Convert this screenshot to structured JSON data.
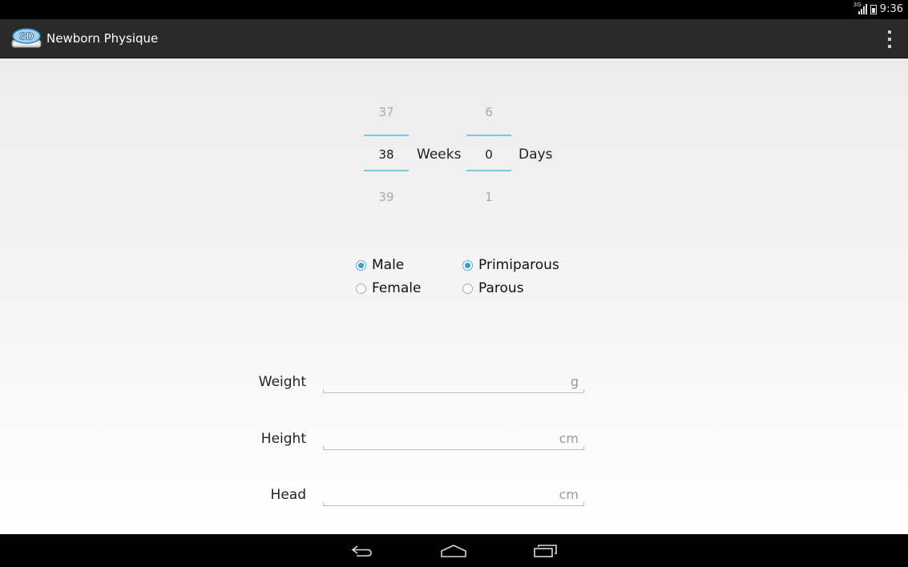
{
  "status_bar": {
    "network_type": "3G",
    "time": "9:36"
  },
  "action_bar": {
    "app_icon_text": "SD",
    "title": "Newborn Physique",
    "overflow_icon": "overflow-menu-icon"
  },
  "gestation_picker": {
    "weeks": {
      "prev": "37",
      "current": "38",
      "next": "39",
      "unit": "Weeks"
    },
    "days": {
      "prev": "6",
      "current": "0",
      "next": "1",
      "unit": "Days"
    },
    "accent_color": "#7ec6e6"
  },
  "sex": {
    "options": [
      {
        "label": "Male",
        "checked": true
      },
      {
        "label": "Female",
        "checked": false
      }
    ]
  },
  "parity": {
    "options": [
      {
        "label": "Primiparous",
        "checked": true
      },
      {
        "label": "Parous",
        "checked": false
      }
    ]
  },
  "measurements": [
    {
      "label": "Weight",
      "value": "",
      "placeholder": "g"
    },
    {
      "label": "Height",
      "value": "",
      "placeholder": "cm"
    },
    {
      "label": "Head",
      "value": "",
      "placeholder": "cm"
    }
  ],
  "nav_bar": {
    "buttons": [
      "back-icon",
      "home-icon",
      "recent-apps-icon"
    ]
  },
  "colors": {
    "radio_checked": "#33a0d6",
    "action_bar_bg": "#2a2a2a"
  }
}
